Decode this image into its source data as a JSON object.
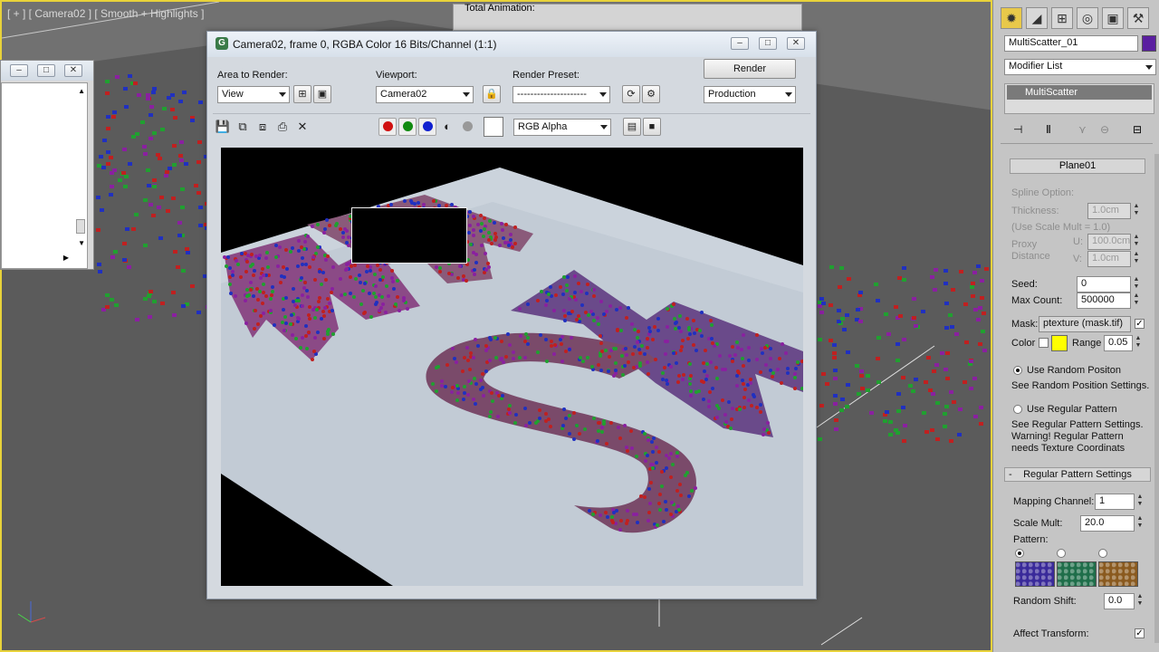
{
  "viewport": {
    "label": "[ + ] [ Camera02 ] [ Smooth + Highlights ]",
    "bg_color": "#717171",
    "border_color": "#e8d23a"
  },
  "left_window": {
    "min": "–",
    "max": "□",
    "close": "✕"
  },
  "render_window": {
    "title": "Camera02, frame 0, RGBA Color 16 Bits/Channel (1:1)",
    "area_label": "Area to Render:",
    "area_value": "View",
    "viewport_label": "Viewport:",
    "viewport_value": "Camera02",
    "preset_label": "Render Preset:",
    "preset_value": "---------------------",
    "render_button": "Render",
    "production_value": "Production",
    "channel_value": "RGB Alpha",
    "bg_behind_title": "Total Animation:"
  },
  "render_image": {
    "letters": [
      "M",
      "A",
      "S",
      "K"
    ]
  },
  "command_panel": {
    "object_name": "MultiScatter_01",
    "object_color": "#5a1fa0",
    "modifier_list": "Modifier List",
    "modifier_item": "MultiScatter",
    "plane_button": "Plane01",
    "spline_option": "Spline Option:",
    "thickness_label": "Thickness:",
    "thickness_value": "1.0cm",
    "use_scale_mult": "(Use Scale Mult = 1.0)",
    "proxy_label": "Proxy",
    "distance_label": "Distance",
    "u_label": "U:",
    "u_value": "100.0cm",
    "v_label": "V:",
    "v_value": "1.0cm",
    "seed_label": "Seed:",
    "seed_value": "0",
    "max_count_label": "Max Count:",
    "max_count_value": "500000",
    "mask_label": "Mask:",
    "mask_value": "ptexture (mask.tif)",
    "color_label": "Color",
    "range_label": "Range",
    "range_value": "0.05",
    "color_swatch": "#ffff00",
    "use_random_label": "Use Random Positon",
    "see_random": "See Random Position Settings.",
    "use_regular_label": "Use Regular Pattern",
    "see_regular_1": "See Regular Pattern Settings.",
    "see_regular_2": "Warning! Regular Pattern",
    "see_regular_3": "needs Texture Coordinats",
    "regular_rollout": "Regular Pattern Settings",
    "rollout_toggle": "-",
    "mapping_label": "Mapping Channel:",
    "mapping_value": "1",
    "scale_mult_label": "Scale Mult:",
    "scale_mult_value": "20.0",
    "pattern_label": "Pattern:",
    "random_shift_label": "Random Shift:",
    "random_shift_value": "0.0",
    "affect_transform_label": "Affect Transform:",
    "pattern_colors": [
      "#3a2a9a",
      "#1f6e4a",
      "#8a5a1f"
    ]
  }
}
